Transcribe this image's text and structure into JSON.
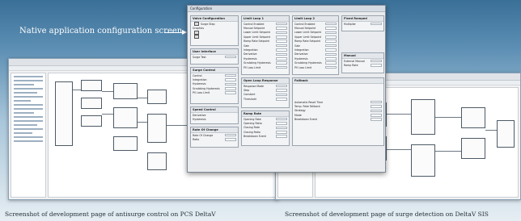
{
  "callout": {
    "label": "Native application configuration screen"
  },
  "captions": {
    "left": "Screenshot of development page of antisurge control on PCS DeltaV",
    "right": "Screenshot of development page of surge detection on DeltaV SIS"
  },
  "dialog": {
    "title": "Configuration",
    "panels": {
      "valve": {
        "title": "Valve Configuration",
        "rows": [
          "Surge Step",
          "Graphics"
        ]
      },
      "user": {
        "title": "User Interface",
        "rows": [
          "Surge Test"
        ]
      },
      "surge": {
        "title": "Surge Control",
        "rows": [
          "Control",
          "Integration",
          "Hysteresis",
          "Scrubbing Hysteresis",
          "PV Loss Limit"
        ]
      },
      "speed": {
        "title": "Speed Control",
        "rows": [
          "Derivative",
          "Hysteresis"
        ]
      },
      "rate": {
        "title": "Rate Of Change",
        "rows": [
          "Rate Of Change",
          "Ratio"
        ]
      },
      "limit1": {
        "title": "Limit Loop 1",
        "rows": [
          "Control Enabled",
          "Manual Setpoint",
          "Lower Limit Setpoint",
          "Upper Limit Setpoint",
          "Ramp Rate Setpoint",
          "Gain",
          "Integration",
          "Derivative",
          "Hysteresis",
          "Scrubbing Hysteresis",
          "PV Loss Limit"
        ]
      },
      "openloop": {
        "title": "Open Loop Response",
        "rows": [
          "Response Mode",
          "Step",
          "Constant",
          "Threshold"
        ]
      },
      "ramp": {
        "title": "Ramp Rate",
        "rows": [
          "Opening Rate",
          "Opening Ratio",
          "Closing Rate",
          "Closing Ratio",
          "Breakdown Event"
        ]
      },
      "limit2": {
        "title": "Limit Loop 2",
        "rows": [
          "Control Enabled",
          "Manual Setpoint",
          "Lower Limit Setpoint",
          "Upper Limit Setpoint",
          "Ramp Rate Setpoint",
          "Gain",
          "Integration",
          "Derivative",
          "Hysteresis",
          "Scrubbing Hysteresis",
          "PV Loss Limit"
        ]
      },
      "fallback": {
        "title": "Fallback",
        "rows": [
          "Automatic Reset Time",
          "Temp. Rate Fallback",
          "Strategy",
          "Mode",
          "Breakdown Event"
        ]
      },
      "fixed": {
        "title": "Fixed Ramped",
        "rows": [
          "Multiplier"
        ]
      },
      "manual": {
        "title": "Manual",
        "rows": [
          "External Manual",
          "Ramp Rate"
        ]
      }
    }
  }
}
